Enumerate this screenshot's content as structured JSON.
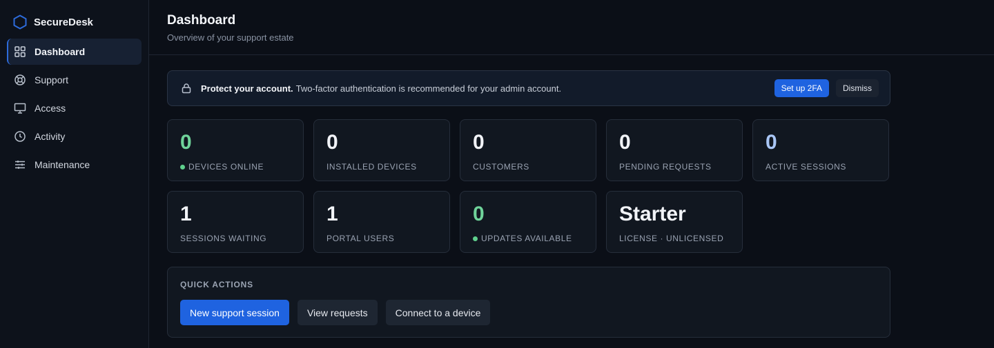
{
  "brand": {
    "name": "SecureDesk",
    "accent": "#2d6bdb"
  },
  "sidebar": {
    "items": [
      {
        "label": "Dashboard",
        "icon": "grid-icon",
        "active": true
      },
      {
        "label": "Support",
        "icon": "lifebuoy-icon"
      },
      {
        "label": "Access",
        "icon": "monitor-icon"
      },
      {
        "label": "Activity",
        "icon": "clock-icon"
      },
      {
        "label": "Maintenance",
        "icon": "sliders-icon"
      }
    ]
  },
  "header": {
    "title": "Dashboard",
    "subtitle": "Overview of your support estate"
  },
  "banner": {
    "icon": "lock-icon",
    "strong": "Protect your account.",
    "text": "Two-factor authentication is recommended for your admin account.",
    "primary_label": "Set up 2FA",
    "secondary_label": "Dismiss"
  },
  "stats": [
    {
      "value": "0",
      "label": "DEVICES ONLINE",
      "color": "green",
      "dot": true
    },
    {
      "value": "0",
      "label": "INSTALLED DEVICES"
    },
    {
      "value": "0",
      "label": "CUSTOMERS"
    },
    {
      "value": "0",
      "label": "PENDING REQUESTS"
    },
    {
      "value": "0",
      "label": "ACTIVE SESSIONS",
      "color": "blue"
    },
    {
      "value": "1",
      "label": "SESSIONS WAITING"
    },
    {
      "value": "1",
      "label": "PORTAL USERS"
    },
    {
      "value": "0",
      "label": "UPDATES AVAILABLE",
      "color": "green",
      "dot": true
    },
    {
      "value": "Starter",
      "label": "LICENSE · UNLICENSED"
    }
  ],
  "quick_actions": {
    "title": "QUICK ACTIONS",
    "buttons": [
      {
        "label": "New support session",
        "primary": true
      },
      {
        "label": "View requests"
      },
      {
        "label": "Connect to a device"
      }
    ]
  }
}
